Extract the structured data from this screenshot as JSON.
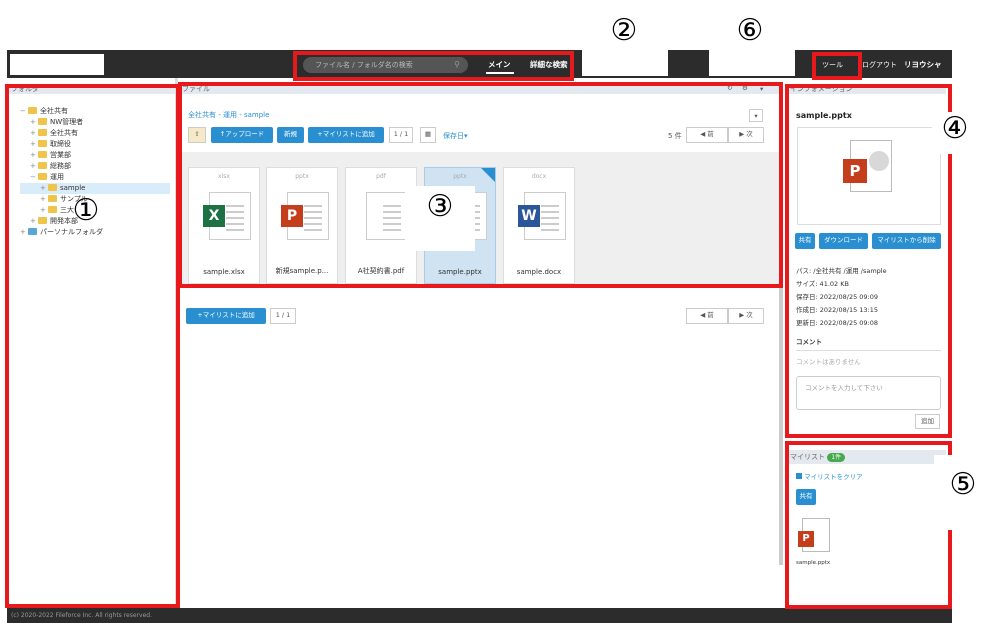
{
  "header": {
    "search_placeholder": "ファイル名 / フォルダ名の検索",
    "nav_main": "メイン",
    "nav_advanced": "詳細な検索",
    "tools": "ツール",
    "logout": "ログアウト",
    "user": "リヨウシャ"
  },
  "callouts": [
    "①",
    "②",
    "③",
    "④",
    "⑤",
    "⑥"
  ],
  "folder_panel": {
    "title": "フォルダ",
    "tree": [
      {
        "pm": "−",
        "label": "全社共有",
        "depth": 0
      },
      {
        "pm": "+",
        "label": "NW管理者",
        "depth": 1
      },
      {
        "pm": "+",
        "label": "全社共有",
        "depth": 1
      },
      {
        "pm": "+",
        "label": "取締役",
        "depth": 1
      },
      {
        "pm": "+",
        "label": "営業部",
        "depth": 1
      },
      {
        "pm": "+",
        "label": "総務部",
        "depth": 1
      },
      {
        "pm": "−",
        "label": "運用",
        "depth": 1
      },
      {
        "pm": "+",
        "label": "sample",
        "depth": 2
      },
      {
        "pm": "+",
        "label": "サンプル",
        "depth": 2
      },
      {
        "pm": "+",
        "label": "三大",
        "depth": 2
      },
      {
        "pm": "+",
        "label": "開発本部",
        "depth": 1
      },
      {
        "pm": "+",
        "label": "パーソナルフォルダ",
        "depth": 0
      }
    ]
  },
  "file_panel": {
    "title": "ファイル",
    "breadcrumb": "全社共有 - 運用 - sample",
    "upload": "アップロード",
    "new": "新規",
    "add_mylist": "マイリストに追加",
    "page": "1 / 1",
    "sort": "保存日▾",
    "count": "5 件",
    "prev": "前",
    "next": "次",
    "files": [
      {
        "ext": "xlsx",
        "name": "sample.xlsx",
        "badge": "X",
        "color": "#1e7145"
      },
      {
        "ext": "pptx",
        "name": "新規sample.p...",
        "badge": "P",
        "color": "#c43e1c"
      },
      {
        "ext": "pdf",
        "name": "A社契約書.pdf",
        "badge": "",
        "color": "#888888"
      },
      {
        "ext": "pptx",
        "name": "sample.pptx",
        "badge": "P",
        "color": "#c43e1c"
      },
      {
        "ext": "docx",
        "name": "sample.docx",
        "badge": "W",
        "color": "#2b579a"
      }
    ],
    "lower_add_mylist": "マイリストに追加",
    "lower_page": "1 / 1"
  },
  "info_panel": {
    "title": "インフォメーション",
    "file_name": "sample.pptx",
    "share": "共有",
    "download": "ダウンロード",
    "remove_mylist": "マイリストから削除",
    "path": "パス: /全社共有 /運用 /sample",
    "size": "サイズ: 41.02 KB",
    "saved": "保存日: 2022/08/25 09:09",
    "created": "作成日: 2022/08/15 13:15",
    "updated": "更新日: 2022/08/25 09:08",
    "comment_label": "コメント",
    "no_comment": "コメントはありません",
    "comment_placeholder": "コメントを入力して下さい",
    "add": "追加"
  },
  "mylist_panel": {
    "title": "マイリスト",
    "count": "1件",
    "clear": "マイリストをクリア",
    "share": "共有",
    "item": "sample.pptx"
  },
  "footer": "(c) 2020-2022 Fileforce Inc. All rights reserved.",
  "colors": {
    "accent": "#2a8fd0",
    "highlight": "#e8191d",
    "topbar": "#2c2c2c"
  }
}
